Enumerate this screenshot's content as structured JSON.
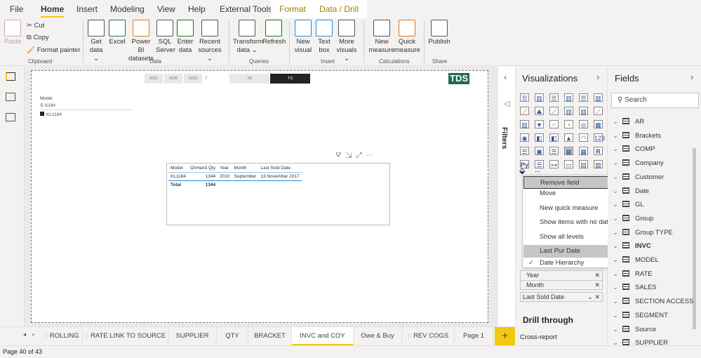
{
  "ribbon_tabs": [
    "File",
    "Home",
    "Insert",
    "Modeling",
    "View",
    "Help",
    "External Tools",
    "Format",
    "Data / Drill"
  ],
  "active_tab": "Home",
  "ribbon": {
    "clipboard": {
      "paste": "Paste",
      "cut": "Cut",
      "copy": "Copy",
      "format_painter": "Format painter",
      "group": "Clipboard"
    },
    "data": {
      "items": [
        "Get data ⌄",
        "Excel",
        "Power BI datasets",
        "SQL Server",
        "Enter data",
        "Recent sources ⌄"
      ],
      "group": "Data"
    },
    "queries": {
      "items": [
        "Transform data ⌄",
        "Refresh"
      ],
      "group": "Queries"
    },
    "insert": {
      "items": [
        "New visual",
        "Text box",
        "More visuals ⌄"
      ],
      "group": "Insert"
    },
    "calculations": {
      "items": [
        "New measure",
        "Quick measure"
      ],
      "group": "Calculations"
    },
    "share": {
      "items": [
        "Publish"
      ],
      "group": "Share"
    }
  },
  "canvas": {
    "year_buttons": [
      "2021",
      "2020",
      "2019"
    ],
    "toggle": [
      "TA",
      "TS"
    ],
    "logo": "TDS",
    "slicer": {
      "title": "Model",
      "search_value": "l1184",
      "item": "KL1184"
    },
    "table": {
      "headers": [
        "Model",
        "OnHand Qty",
        "Year",
        "Month",
        "Last Sold Date"
      ],
      "rows": [
        [
          "KL1184",
          "1344",
          "2010",
          "September",
          "13 November 2017"
        ]
      ],
      "total": [
        "Total",
        "1344"
      ]
    }
  },
  "filters_label": "Filters",
  "visualizations": {
    "title": "Visualizations",
    "more": "...",
    "context_menu": [
      "Remove field",
      "Move",
      "New quick measure",
      "Show items with no data",
      "Show all levels",
      "Last Pur Date",
      "Date Hierarchy"
    ],
    "wells": [
      "Year",
      "Month",
      "Last Sold Date"
    ],
    "drill_through": "Drill through",
    "cross_report": "Cross-report"
  },
  "fields": {
    "title": "Fields",
    "search_placeholder": "Search",
    "items": [
      "AR",
      "Brackets",
      "COMP",
      "Company",
      "Customer",
      "Date",
      "GL",
      "Group",
      "Group TYPE",
      "INVC",
      "MODEL",
      "RATE",
      "SALES",
      "SECTION ACCESS",
      "SEGMENT",
      "Source",
      "SUPPLIER"
    ]
  },
  "page_tabs": [
    "ROLLING",
    "RATE LINK TO SOURCE",
    "SUPPLIER",
    "QTY",
    "BRACKET",
    "INVC and COY",
    "Owe & Buy",
    "REV COGS",
    "Page 1"
  ],
  "active_page": "INVC and COY",
  "add_page": "+",
  "status": "Page 40 of 43",
  "colors": {
    "accent": "#f2c811",
    "logo": "#1e6b52",
    "context_tab": "#a08000"
  }
}
